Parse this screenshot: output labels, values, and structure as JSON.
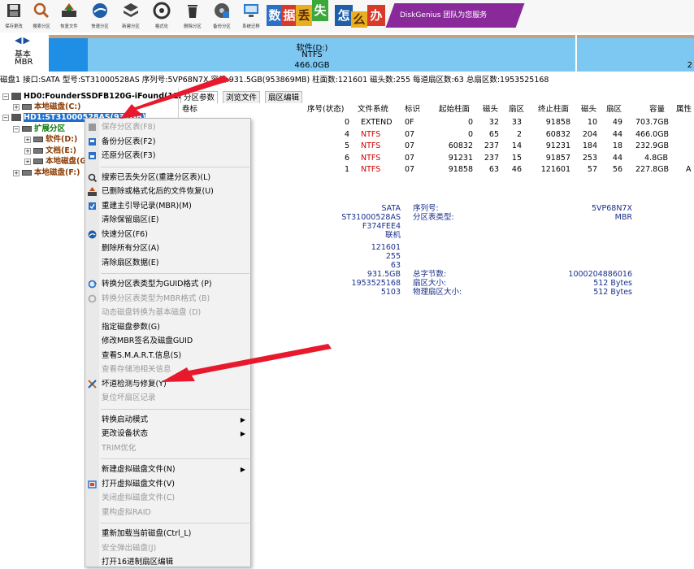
{
  "toolbar": {
    "buttons": [
      {
        "label": "保存更改",
        "icon": "save-icon"
      },
      {
        "label": "搜索分区",
        "icon": "search-icon"
      },
      {
        "label": "恢复文件",
        "icon": "recover-icon"
      },
      {
        "label": "快速分区",
        "icon": "quick-partition-icon"
      },
      {
        "label": "新建分区",
        "icon": "new-partition-icon"
      },
      {
        "label": "格式化",
        "icon": "format-icon"
      },
      {
        "label": "删除分区",
        "icon": "delete-icon"
      },
      {
        "label": "备份分区",
        "icon": "backup-icon"
      },
      {
        "label": "系统迁移",
        "icon": "migrate-icon"
      }
    ],
    "banner": {
      "chars": [
        "数",
        "据",
        "丢",
        "失",
        "怎",
        "么",
        "办"
      ],
      "product": "DiskGenius 团队为您服务"
    }
  },
  "diskbar": {
    "nav": "◀▶",
    "type": "基本",
    "style": "MBR",
    "segment_main": {
      "name": "软件(D:)",
      "fs": "NTFS",
      "size": "466.0GB"
    },
    "segment_2_size": "2"
  },
  "diskinfo": "磁盘1 接口:SATA  型号:ST31000528AS  序列号:5VP68N7X  容量:931.5GB(953869MB)  柱面数:121601  磁头数:255  每道扇区数:63  总扇区数:1953525168",
  "tree": {
    "hd0": "HD0:FounderSSDFB120G-iFound(112G",
    "hd0_local_c": "本地磁盘(C:)",
    "hd1": "HD1:ST31000528AS(931GB)",
    "ext": "扩展分区",
    "soft_d": "软件(D:)",
    "doc_e": "文档(E:)",
    "local_g": "本地磁盘(G",
    "local_f": "本地磁盘(F:)"
  },
  "tabs": [
    "分区参数",
    "浏览文件",
    "扇区编辑"
  ],
  "ptable": {
    "headers": [
      "卷标",
      "序号(状态)",
      "文件系统",
      "标识",
      "起始柱面",
      "磁头",
      "扇区",
      "终止柱面",
      "磁头",
      "扇区",
      "容量",
      "属性"
    ],
    "rows": [
      {
        "label": "",
        "index": "0",
        "fs": "EXTEND",
        "id": "0F",
        "start_cyl": "0",
        "start_head": "32",
        "start_sec": "33",
        "end_cyl": "91858",
        "end_head": "10",
        "end_sec": "49",
        "size": "703.7GB",
        "attr": ""
      },
      {
        "label": "",
        "index": "4",
        "fs": "NTFS",
        "id": "07",
        "start_cyl": "0",
        "start_head": "65",
        "start_sec": "2",
        "end_cyl": "60832",
        "end_head": "204",
        "end_sec": "44",
        "size": "466.0GB",
        "attr": ""
      },
      {
        "label": "",
        "index": "5",
        "fs": "NTFS",
        "id": "07",
        "start_cyl": "60832",
        "start_head": "237",
        "start_sec": "14",
        "end_cyl": "91231",
        "end_head": "184",
        "end_sec": "18",
        "size": "232.9GB",
        "attr": ""
      },
      {
        "label": "G:)",
        "index": "6",
        "fs": "NTFS",
        "id": "07",
        "start_cyl": "91231",
        "start_head": "237",
        "start_sec": "15",
        "end_cyl": "91857",
        "end_head": "253",
        "end_sec": "44",
        "size": "4.8GB",
        "attr": ""
      },
      {
        "label": "",
        "index": "1",
        "fs": "NTFS",
        "id": "07",
        "start_cyl": "91858",
        "start_head": "63",
        "start_sec": "46",
        "end_cyl": "121601",
        "end_head": "57",
        "end_sec": "56",
        "size": "227.8GB",
        "attr": "A"
      }
    ]
  },
  "details": {
    "iface": "SATA",
    "model": "ST31000528AS",
    "fw": "F374FEE4",
    "status": "联机",
    "cyl": "121601",
    "heads": "255",
    "spt": "63",
    "cap": "931.5GB",
    "total_sectors": "1953525168",
    "extra": "5103",
    "serial_label": "序列号:",
    "serial": "5VP68N7X",
    "ptt_label": "分区表类型:",
    "ptt": "MBR",
    "bytes_label": "总字节数:",
    "bytes": "1000204886016",
    "sec_label": "扇区大小:",
    "sec": "512 Bytes",
    "psec_label": "物理扇区大小:",
    "psec": "512 Bytes"
  },
  "menu": [
    {
      "label": "保存分区表(F8)",
      "disabled": true,
      "icon": "save-icon"
    },
    {
      "label": "备份分区表(F2)",
      "disabled": false,
      "icon": "backup-table-icon"
    },
    {
      "label": "还原分区表(F3)",
      "disabled": false,
      "icon": "restore-table-icon"
    },
    {
      "sep": true
    },
    {
      "label": "搜索已丢失分区(重建分区表)(L)",
      "disabled": false,
      "icon": "search-icon"
    },
    {
      "label": "已删除或格式化后的文件恢复(U)",
      "disabled": false,
      "icon": "recover-icon"
    },
    {
      "label": "重建主引导记录(MBR)(M)",
      "disabled": false,
      "icon": "mbr-icon"
    },
    {
      "label": "清除保留扇区(E)",
      "disabled": false
    },
    {
      "label": "快速分区(F6)",
      "disabled": false,
      "icon": "quick-partition-icon"
    },
    {
      "label": "删除所有分区(A)",
      "disabled": false
    },
    {
      "label": "清除扇区数据(E)",
      "disabled": false
    },
    {
      "sep": true
    },
    {
      "label": "转换分区表类型为GUID格式 (P)",
      "disabled": false,
      "icon": "convert-icon"
    },
    {
      "label": "转换分区表类型为MBR格式 (B)",
      "disabled": true,
      "icon": "convert-mbr-icon"
    },
    {
      "label": "动态磁盘转换为基本磁盘 (D)",
      "disabled": true
    },
    {
      "label": "指定磁盘参数(G)",
      "disabled": false
    },
    {
      "label": "修改MBR签名及磁盘GUID",
      "disabled": false
    },
    {
      "label": "查看S.M.A.R.T.信息(S)",
      "disabled": false
    },
    {
      "label": "查看存储池相关信息",
      "disabled": true
    },
    {
      "label": "坏道检测与修复(Y)",
      "disabled": false,
      "icon": "bad-sector-icon"
    },
    {
      "label": "复位坏扇区记录",
      "disabled": true
    },
    {
      "sep": true
    },
    {
      "label": "转换启动模式",
      "disabled": false,
      "sub": true
    },
    {
      "label": "更改设备状态",
      "disabled": false,
      "sub": true
    },
    {
      "label": "TRIM优化",
      "disabled": true
    },
    {
      "sep": true
    },
    {
      "label": "新建虚拟磁盘文件(N)",
      "disabled": false,
      "sub": true
    },
    {
      "label": "打开虚拟磁盘文件(V)",
      "disabled": false,
      "icon": "open-vdisk-icon"
    },
    {
      "label": "关闭虚拟磁盘文件(C)",
      "disabled": true
    },
    {
      "label": "重构虚拟RAID",
      "disabled": true
    },
    {
      "sep": true
    },
    {
      "label": "重新加载当前磁盘(Ctrl_L)",
      "disabled": false
    },
    {
      "label": "安全弹出磁盘(J)",
      "disabled": true
    },
    {
      "label": "打开16进制扇区编辑",
      "disabled": false
    }
  ],
  "colors": {
    "accent": "#1c6fd0",
    "partition_blue": "#7dc8f3",
    "partition_dark": "#1f8fe5",
    "arrow": "#e8192c",
    "fs_red": "#d00000"
  }
}
